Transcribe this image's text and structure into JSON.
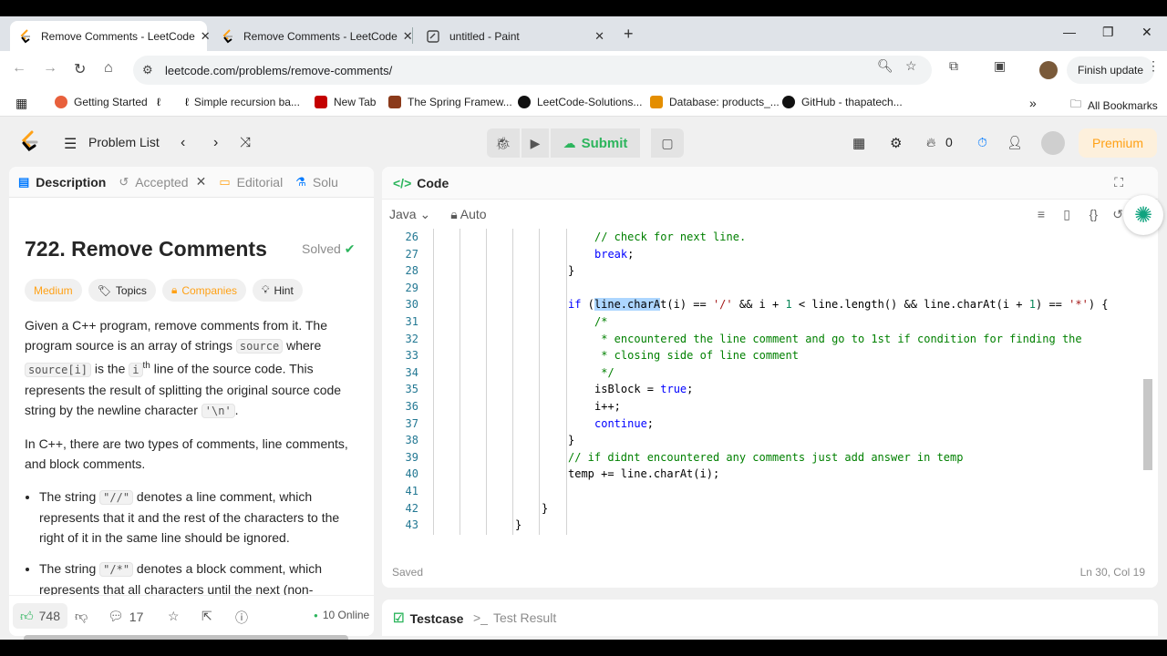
{
  "browser": {
    "tabs": [
      {
        "title": "Remove Comments - LeetCode",
        "icon": "leetcode-icon"
      },
      {
        "title": "Remove Comments - LeetCode",
        "icon": "leetcode-icon"
      },
      {
        "title": "untitled - Paint",
        "icon": "paint-icon"
      }
    ],
    "url": "leetcode.com/problems/remove-comments/",
    "finish_update_label": "Finish update",
    "bookmarks": [
      {
        "label": "Getting Started",
        "color": "#e8603c"
      },
      {
        "label": "Simple recursion ba...",
        "color": "#333"
      },
      {
        "label": "New Tab",
        "color": "#c40000"
      },
      {
        "label": "The Spring Framew...",
        "color": "#6db33f"
      },
      {
        "label": "LeetCode-Solutions...",
        "color": "#111"
      },
      {
        "label": "Database: products_...",
        "color": "#e48e00"
      },
      {
        "label": "GitHub - thapatech...",
        "color": "#111"
      }
    ],
    "all_bookmarks_label": "All Bookmarks"
  },
  "nav": {
    "problem_list_label": "Problem List",
    "submit_label": "Submit",
    "points": "0",
    "premium_label": "Premium"
  },
  "left": {
    "tabs": [
      "Description",
      "Accepted",
      "Editorial",
      "Solu"
    ],
    "title": "722. Remove Comments",
    "solved_label": "Solved",
    "pills": [
      "Medium",
      "Topics",
      "Companies",
      "Hint"
    ],
    "p1_a": "Given a C++ program, remove comments from it. The program source is an array of strings ",
    "p1_code1": "source",
    "p1_b": " where ",
    "p1_code2": "source[i]",
    "p1_c": " is the ",
    "p1_i": "i",
    "p1_sup": "th",
    "p1_d": " line of the source code. This represents the result of splitting the original source code string by the newline character ",
    "p1_code3": "'\\n'",
    "p1_e": ".",
    "p2": "In C++, there are two types of comments, line comments, and block comments.",
    "b1_a": "The string ",
    "b1_code": "\"//\"",
    "b1_b": " denotes a line comment, which represents that it and the rest of the characters to the right of it in the same line should be ignored.",
    "b2_a": "The string ",
    "b2_code": "\"/*\"",
    "b2_b": " denotes a block comment, which represents that all characters until the next (non-",
    "likes": "748",
    "comments": "17",
    "online": "10 Online"
  },
  "code": {
    "header": "Code",
    "language": "Java",
    "mode": "Auto",
    "saved": "Saved",
    "cursor": "Ln 30, Col 19",
    "lines": [
      {
        "n": "26",
        "segs": [
          [
            "cm",
            "// check for next line."
          ]
        ]
      },
      {
        "n": "27",
        "segs": [
          [
            "kw",
            "break"
          ],
          [
            "",
            "; "
          ]
        ]
      },
      {
        "n": "28",
        "segs": [
          [
            "",
            "}"
          ]
        ]
      },
      {
        "n": "29",
        "segs": []
      },
      {
        "n": "30",
        "segs": [
          [
            "kw",
            "if"
          ],
          [
            "",
            " ("
          ],
          [
            "sel",
            "line.charA"
          ],
          [
            "",
            "t(i) == "
          ],
          [
            "st",
            "'/'"
          ],
          [
            "",
            " && i + "
          ],
          [
            "nm",
            "1"
          ],
          [
            "",
            " < line.length() && line.charAt(i + "
          ],
          [
            "nm",
            "1"
          ],
          [
            "",
            ") == "
          ],
          [
            "st",
            "'*'"
          ],
          [
            "",
            ") {"
          ]
        ]
      },
      {
        "n": "31",
        "segs": [
          [
            "cm",
            "/*"
          ]
        ]
      },
      {
        "n": "32",
        "segs": [
          [
            "cm",
            " * encountered the line comment and go to 1st if condition for finding the"
          ]
        ]
      },
      {
        "n": "33",
        "segs": [
          [
            "cm",
            " * closing side of line comment"
          ]
        ]
      },
      {
        "n": "34",
        "segs": [
          [
            "cm",
            " */"
          ]
        ]
      },
      {
        "n": "35",
        "segs": [
          [
            "",
            "isBlock = "
          ],
          [
            "kw",
            "true"
          ],
          [
            "",
            ";"
          ]
        ]
      },
      {
        "n": "36",
        "segs": [
          [
            "",
            "i++;"
          ]
        ]
      },
      {
        "n": "37",
        "segs": [
          [
            "kw",
            "continue"
          ],
          [
            "",
            ";"
          ]
        ]
      },
      {
        "n": "38",
        "segs": [
          [
            "",
            "}"
          ]
        ]
      },
      {
        "n": "39",
        "segs": [
          [
            "cm",
            "// if didnt encountered any comments just add answer in temp"
          ]
        ]
      },
      {
        "n": "40",
        "segs": [
          [
            "",
            "temp += line.charAt(i);"
          ]
        ]
      },
      {
        "n": "41",
        "segs": []
      },
      {
        "n": "42",
        "segs": [
          [
            "",
            "}"
          ]
        ]
      },
      {
        "n": "43",
        "segs": [
          [
            "",
            "}"
          ]
        ]
      }
    ]
  },
  "bottom": {
    "testcase_label": "Testcase",
    "result_label": "Test Result"
  }
}
